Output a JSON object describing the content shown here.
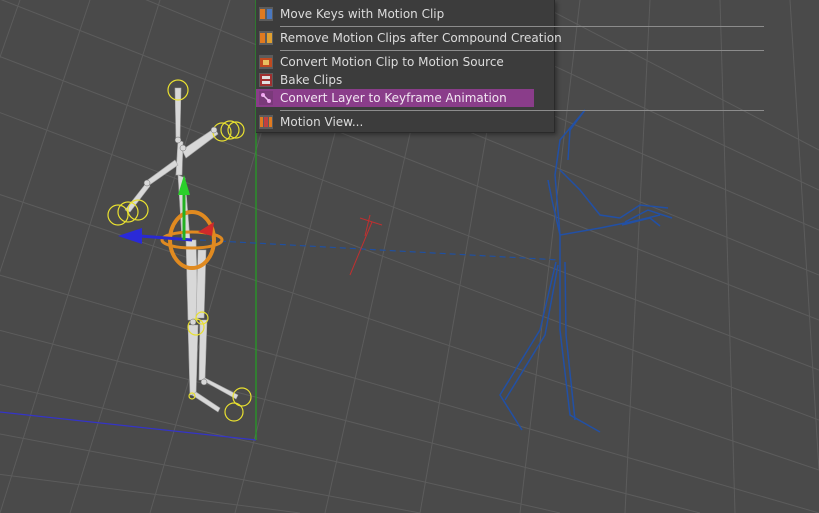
{
  "menu": {
    "items": [
      {
        "label": "Move Keys with Motion Clip",
        "icon": "clip-keys-icon"
      },
      {
        "label": "Remove Motion Clips after Compound Creation",
        "icon": "clip-remove-icon"
      },
      {
        "label": "Convert Motion Clip to Motion Source",
        "icon": "clip-convert-icon"
      },
      {
        "label": "Bake Clips",
        "icon": "bake-clips-icon"
      },
      {
        "label": "Convert Layer to Keyframe Animation",
        "icon": "layer-keyframe-icon"
      },
      {
        "label": "Motion View...",
        "icon": "motion-view-icon"
      }
    ],
    "highlighted_index": 4
  },
  "colors": {
    "viewport_bg": "#4a4a4a",
    "grid_line": "#5a5a5a",
    "menu_bg": "#3c3c3c",
    "menu_highlight": "#8a3d8a",
    "menu_text": "#dcdcdc",
    "axis_x": "#3030c0",
    "axis_y": "#20a020",
    "skeleton_selected": "#d8d8d8",
    "joint_ring": "#e8e030",
    "ghost_skeleton": "#2050a0",
    "manipulator_rotate": "#e08a20"
  }
}
